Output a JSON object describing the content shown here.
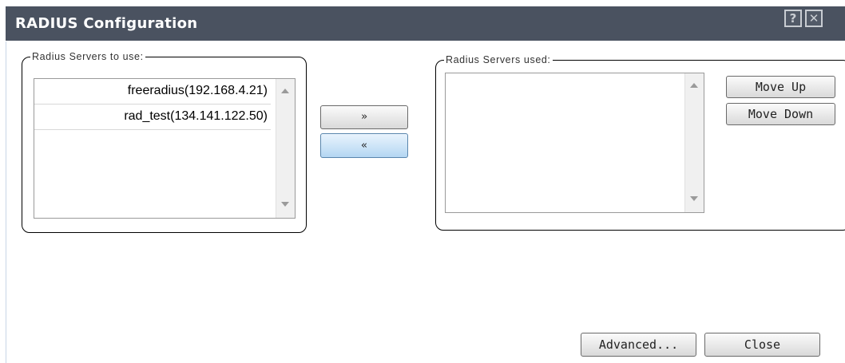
{
  "window": {
    "title": "RADIUS Configuration",
    "help_label": "?",
    "close_label": "✕"
  },
  "left_group": {
    "legend": "Radius Servers to use:",
    "items": [
      {
        "label": "freeradius(192.168.4.21)"
      },
      {
        "label": "rad_test(134.141.122.50)"
      }
    ]
  },
  "right_group": {
    "legend": "Radius Servers used:",
    "items": []
  },
  "transfer": {
    "add_label": "»",
    "remove_label": "«"
  },
  "order": {
    "move_up_label": "Move Up",
    "move_down_label": "Move Down"
  },
  "footer": {
    "advanced_label": "Advanced...",
    "close_label": "Close"
  }
}
